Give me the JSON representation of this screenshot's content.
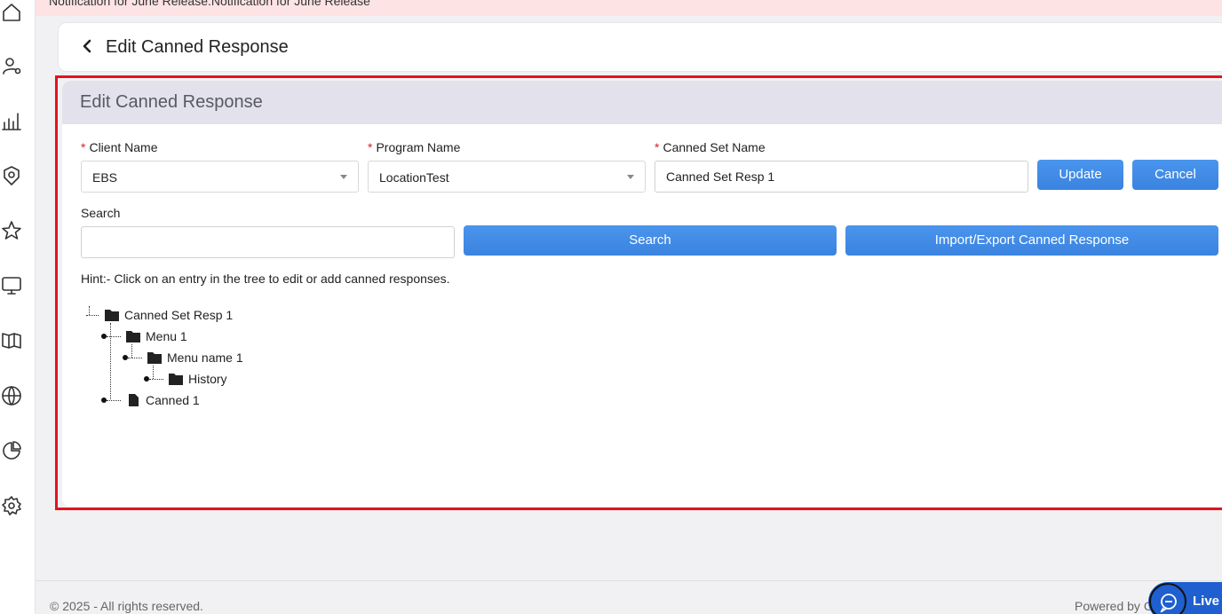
{
  "notification": {
    "text": "Notification for June Release.Notification for June Release"
  },
  "header": {
    "title": "Edit Canned Response"
  },
  "panel": {
    "title": "Edit Canned Response"
  },
  "form": {
    "client_name": {
      "label": "Client Name",
      "required_mark": "*",
      "value": "EBS"
    },
    "program_name": {
      "label": "Program Name",
      "required_mark": "*",
      "value": "LocationTest"
    },
    "canned_set_name": {
      "label": "Canned Set Name",
      "required_mark": "*",
      "value": "Canned Set Resp 1"
    },
    "update_label": "Update",
    "cancel_label": "Cancel",
    "search_label": "Search",
    "search_value": "",
    "search_button": "Search",
    "import_export_button": "Import/Export Canned Response"
  },
  "hint": "Hint:- Click on an entry in the tree to edit or add canned responses.",
  "tree": {
    "root": {
      "label": "Canned Set Resp 1",
      "icon": "folder-icon"
    },
    "menu1": {
      "label": "Menu 1",
      "icon": "folder-icon"
    },
    "menu_name1": {
      "label": "Menu name 1",
      "icon": "folder-icon"
    },
    "history": {
      "label": "History",
      "icon": "folder-icon"
    },
    "canned1": {
      "label": "Canned 1",
      "icon": "file-icon"
    }
  },
  "footer": {
    "copyright": "© 2025 - All rights reserved.",
    "powered_by": "Powered by C",
    "live_chat": "Live c"
  },
  "sidebar": {
    "icons": [
      "home-icon",
      "user-settings-icon",
      "bar-chart-icon",
      "badge-icon",
      "star-icon",
      "monitor-icon",
      "book-icon",
      "globe-icon",
      "pie-chart-icon",
      "gear-icon"
    ]
  },
  "colors": {
    "accent": "#3a83e0",
    "highlight_frame": "#e3141a",
    "panel_header": "#e3e1ec",
    "notification_bg": "#fde3e3"
  }
}
